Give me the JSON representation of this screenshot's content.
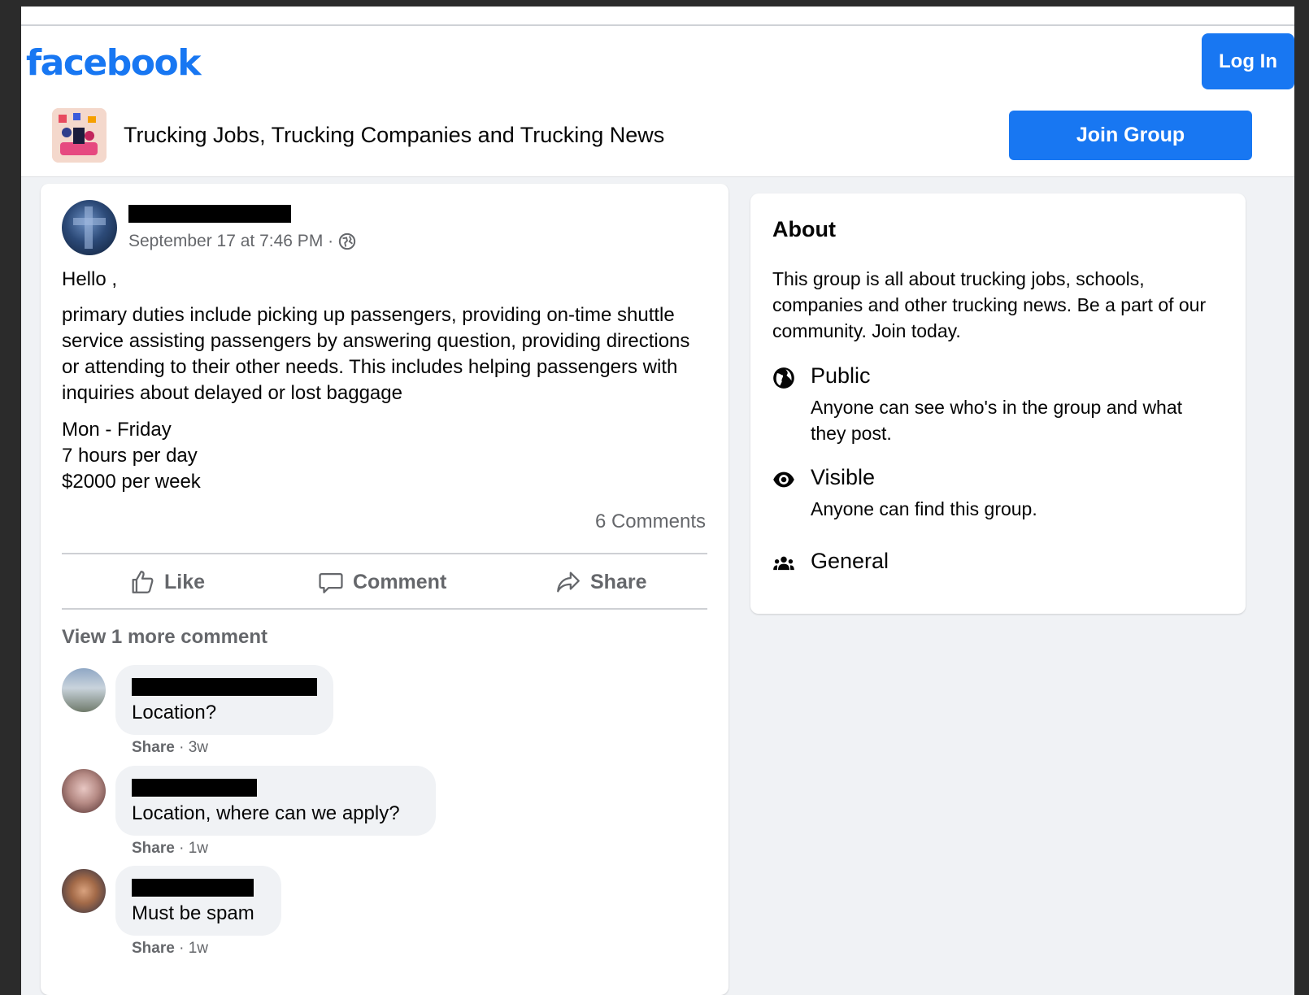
{
  "header": {
    "logo": "facebook",
    "login_label": "Log In"
  },
  "group": {
    "name": "Trucking Jobs, Trucking Companies and Trucking News",
    "join_label": "Join Group"
  },
  "post": {
    "timestamp": "September 17 at 7:46 PM ·",
    "greeting": "Hello ,",
    "body": "primary duties include picking up passengers, providing on-time shuttle service assisting passengers by answering question, providing directions or attending to their other needs. This includes helping passengers with inquiries about delayed or lost baggage",
    "schedule_days": "Mon - Friday",
    "schedule_hours": "7 hours per day",
    "pay": "$2000 per week",
    "comments_count": "6 Comments",
    "actions": {
      "like": "Like",
      "comment": "Comment",
      "share": "Share"
    },
    "view_more": "View 1 more comment",
    "comments": [
      {
        "text": "Location?",
        "share": "Share",
        "age": "· 3w"
      },
      {
        "text": "Location, where can we apply?",
        "share": "Share",
        "age": "· 1w"
      },
      {
        "text": "Must be spam",
        "share": "Share",
        "age": "· 1w"
      }
    ]
  },
  "about": {
    "title": "About",
    "description": "This group is all about trucking jobs, schools, companies and other trucking news. Be a part of our community. Join today.",
    "privacy_label": "Public",
    "privacy_desc": "Anyone can see who's in the group and what they post.",
    "visibility_label": "Visible",
    "visibility_desc": "Anyone can find this group.",
    "category_label": "General"
  },
  "colors": {
    "brand": "#1877f2",
    "page_bg": "#f0f2f5",
    "muted_text": "#65676b",
    "redaction": "#000000"
  },
  "icons": [
    "globe-icon",
    "thumbs-up-icon",
    "comment-icon",
    "share-arrow-icon",
    "eye-icon",
    "people-icon"
  ]
}
